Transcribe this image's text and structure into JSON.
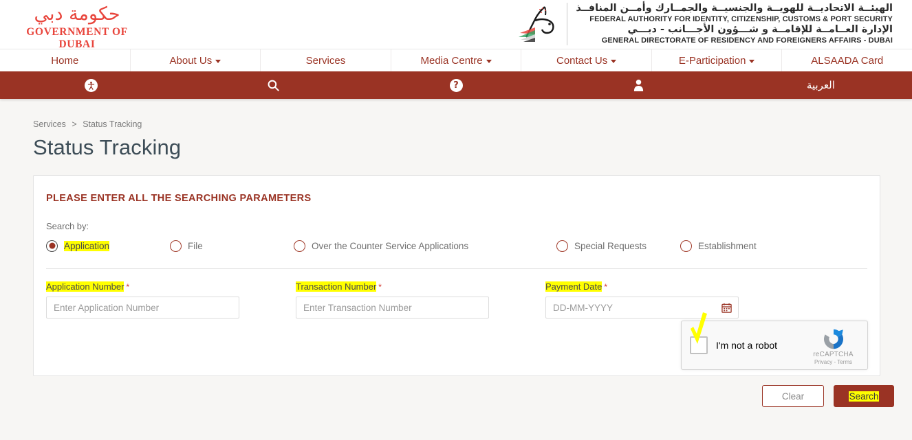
{
  "header": {
    "dubai_logo": {
      "arabic": "حكومة دبي",
      "english": "GOVERNMENT OF DUBAI",
      "icon": "dubai-government-logo"
    },
    "federal_logo": {
      "arabic_line1": "الهيئــة الاتحاديــة للهويــة والجنسيــة والجمــارك وأمــن المنافــذ",
      "english_line1": "FEDERAL AUTHORITY FOR IDENTITY, CITIZENSHIP, CUSTOMS & PORT SECURITY",
      "arabic_line2": "الإدارة العــامــة للإقامــة و شـــؤون الأجـــانب - دبـــي",
      "english_line2": "GENERAL DIRECTORATE OF RESIDENCY AND FOREIGNERS AFFAIRS - DUBAI",
      "icon": "falcon-emblem-icon"
    }
  },
  "nav": {
    "items": [
      {
        "label": "Home",
        "has_caret": false
      },
      {
        "label": "About Us",
        "has_caret": true
      },
      {
        "label": "Services",
        "has_caret": false
      },
      {
        "label": "Media Centre",
        "has_caret": true
      },
      {
        "label": "Contact Us",
        "has_caret": true
      },
      {
        "label": "E-Participation",
        "has_caret": true
      },
      {
        "label": "ALSAADA Card",
        "has_caret": false
      }
    ]
  },
  "utility_bar": {
    "accessibility_icon": "accessibility-icon",
    "search_icon": "search-icon",
    "help_icon": "help-icon",
    "user_icon": "user-icon",
    "language_label": "العربية"
  },
  "breadcrumb": {
    "parent": "Services",
    "separator": ">",
    "current": "Status Tracking"
  },
  "page": {
    "title": "Status Tracking"
  },
  "form": {
    "panel_title": "PLEASE ENTER ALL THE SEARCHING PARAMETERS",
    "search_by_label": "Search by:",
    "radio_options": [
      {
        "label": "Application",
        "selected": true,
        "highlighted": true
      },
      {
        "label": "File",
        "selected": false,
        "highlighted": false
      },
      {
        "label": "Over the Counter Service Applications",
        "selected": false,
        "highlighted": false
      },
      {
        "label": "Special Requests",
        "selected": false,
        "highlighted": false
      },
      {
        "label": "Establishment",
        "selected": false,
        "highlighted": false
      }
    ],
    "fields": [
      {
        "label": "Application Number",
        "required_mark": "*",
        "placeholder": "Enter Application Number",
        "value": "",
        "highlighted": true
      },
      {
        "label": "Transaction Number",
        "required_mark": "*",
        "placeholder": "Enter Transaction Number",
        "value": "",
        "highlighted": true
      },
      {
        "label": "Payment Date",
        "required_mark": "*",
        "placeholder": "DD-MM-YYYY",
        "value": "",
        "highlighted": true,
        "icon": "calendar-icon"
      }
    ]
  },
  "recaptcha": {
    "checkbox_label": "I'm not a robot",
    "brand_name": "reCAPTCHA",
    "links": "Privacy - Terms",
    "checked": false,
    "icon": "recaptcha-logo-icon"
  },
  "actions": {
    "clear_label": "Clear",
    "search_label": "Search"
  },
  "colors": {
    "brand_red": "#9a3324",
    "logo_red": "#e8453c",
    "highlight_yellow": "#ffff00",
    "title_slate": "#3d4d57",
    "page_bg": "#f7f6f4"
  }
}
